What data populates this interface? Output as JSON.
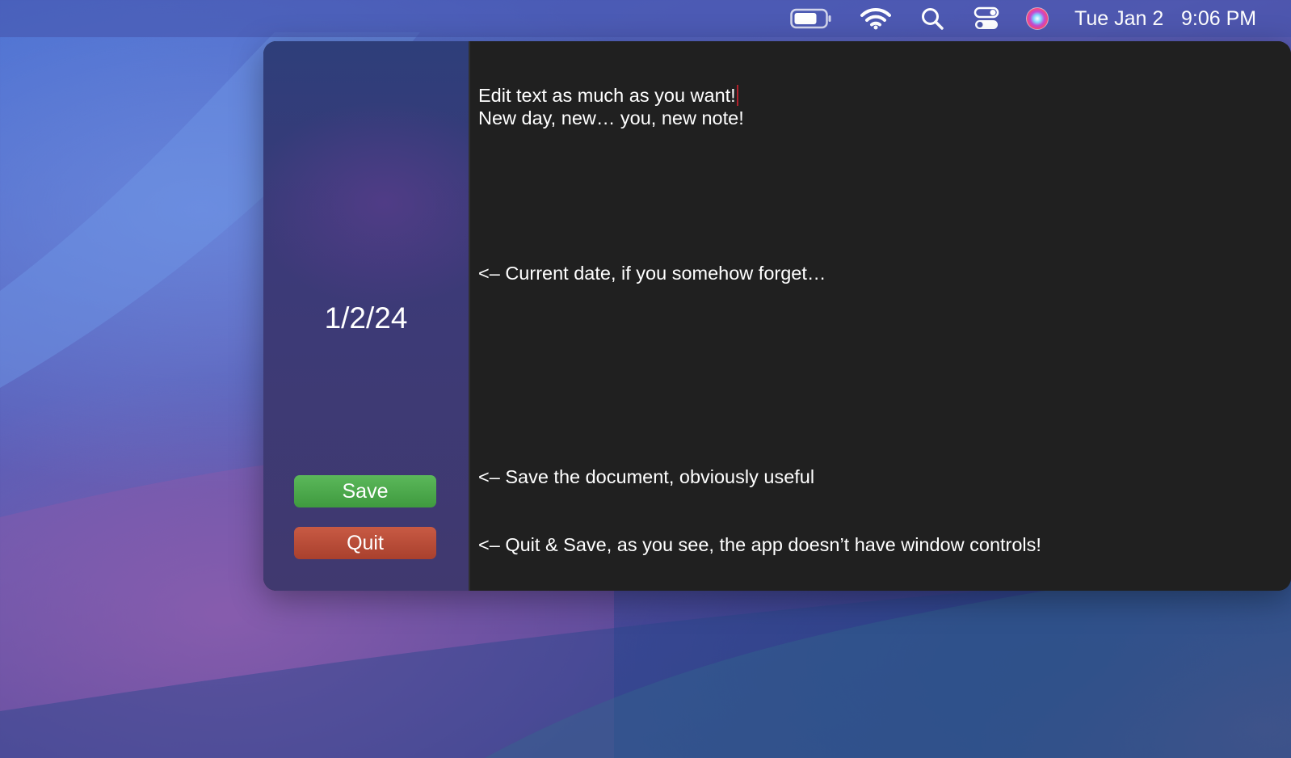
{
  "menubar": {
    "icons": [
      "battery-icon",
      "wifi-icon",
      "spotlight-search-icon",
      "control-center-icon",
      "siri-icon"
    ],
    "day": "Tue Jan 2",
    "time": "9:06 PM"
  },
  "app": {
    "sidebar": {
      "date": "1/2/24",
      "save_label": "Save",
      "quit_label": "Quit",
      "save_color": "#4caa4b",
      "quit_color": "#b84a35"
    },
    "editor": {
      "lines": [
        "Edit text as much as you want!",
        "New day, new… you, new note!",
        "<– Current date, if you somehow forget…",
        "<– Save the document, obviously useful",
        "<– Quit & Save, as you see, the app doesn’t have window controls!"
      ]
    }
  }
}
